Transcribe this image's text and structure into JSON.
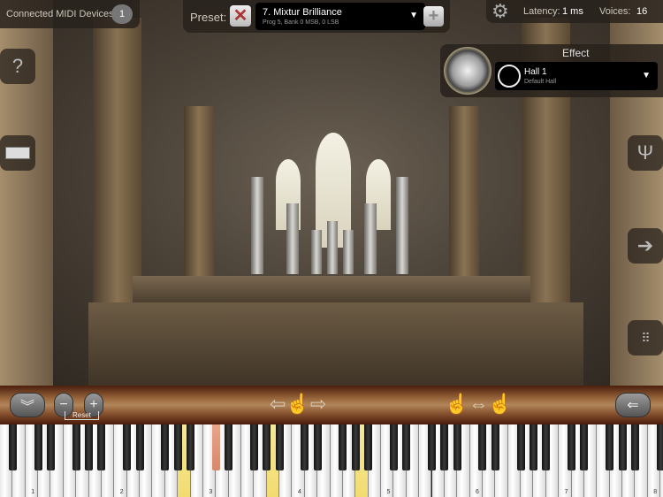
{
  "midi": {
    "label": "Connected MIDI Devices:",
    "count": "1"
  },
  "preset": {
    "label": "Preset:",
    "name": "7. Mixtur Brilliance",
    "detail": "Prog 5, Bank 0 MSB, 0 LSB"
  },
  "status": {
    "latency_label": "Latency:",
    "latency": "1 ms",
    "voices_label": "Voices:",
    "voices": "16"
  },
  "effect": {
    "title": "Effect",
    "name": "Hall 1",
    "detail": "Default Hall"
  },
  "controls": {
    "reset_label": "Reset"
  },
  "keyboard": {
    "octave_labels": [
      "1",
      "2",
      "3",
      "4",
      "5",
      "6",
      "7",
      "8"
    ],
    "highlighted_white_keys": [
      "A2",
      "A3",
      "A4"
    ],
    "pressed_black_keys": [
      "C#3"
    ],
    "highlight_color": "#f2dc70",
    "pressed_color": "#e09a7e"
  },
  "icons": {
    "help": "question-icon",
    "midi": "midi-keyboard-icon",
    "settings": "gear-icon",
    "tuning": "tuning-fork-icon",
    "next": "arrow-right-icon",
    "grid": "grid-icon"
  }
}
